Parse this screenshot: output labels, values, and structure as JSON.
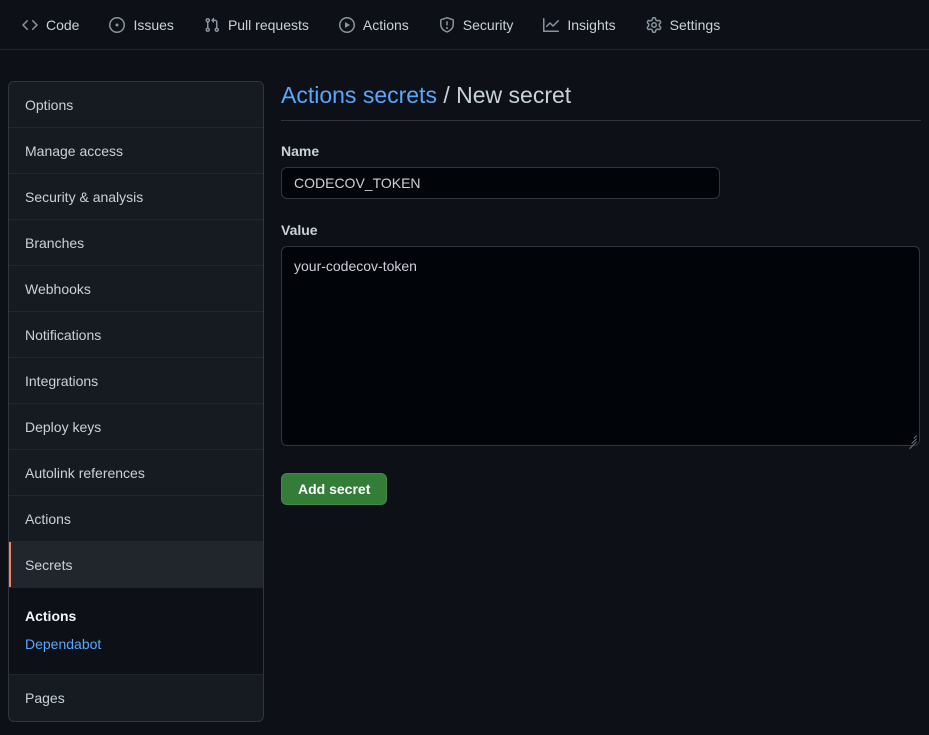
{
  "repo_nav": {
    "items": [
      {
        "label": "Code",
        "icon": "code-icon"
      },
      {
        "label": "Issues",
        "icon": "issue-opened-icon"
      },
      {
        "label": "Pull requests",
        "icon": "git-pull-request-icon"
      },
      {
        "label": "Actions",
        "icon": "play-circle-icon"
      },
      {
        "label": "Security",
        "icon": "shield-icon"
      },
      {
        "label": "Insights",
        "icon": "graph-icon"
      },
      {
        "label": "Settings",
        "icon": "gear-icon"
      }
    ]
  },
  "sidebar": {
    "items": [
      {
        "label": "Options",
        "selected": false
      },
      {
        "label": "Manage access",
        "selected": false
      },
      {
        "label": "Security & analysis",
        "selected": false
      },
      {
        "label": "Branches",
        "selected": false
      },
      {
        "label": "Webhooks",
        "selected": false
      },
      {
        "label": "Notifications",
        "selected": false
      },
      {
        "label": "Integrations",
        "selected": false
      },
      {
        "label": "Deploy keys",
        "selected": false
      },
      {
        "label": "Autolink references",
        "selected": false
      },
      {
        "label": "Actions",
        "selected": false
      },
      {
        "label": "Secrets",
        "selected": true
      }
    ],
    "secrets_subitems": [
      {
        "label": "Actions",
        "state": "current"
      },
      {
        "label": "Dependabot",
        "state": "link"
      }
    ],
    "items_after": [
      {
        "label": "Pages",
        "selected": false
      }
    ],
    "selected_accent": "#f78166"
  },
  "main": {
    "breadcrumb": {
      "parent": "Actions secrets",
      "separator": "/",
      "current": "New secret"
    },
    "name_field": {
      "label": "Name",
      "value": "CODECOV_TOKEN",
      "placeholder": ""
    },
    "value_field": {
      "label": "Value",
      "value": "your-codecov-token",
      "placeholder": ""
    },
    "submit_button": {
      "label": "Add secret",
      "color": "#347d39"
    }
  }
}
